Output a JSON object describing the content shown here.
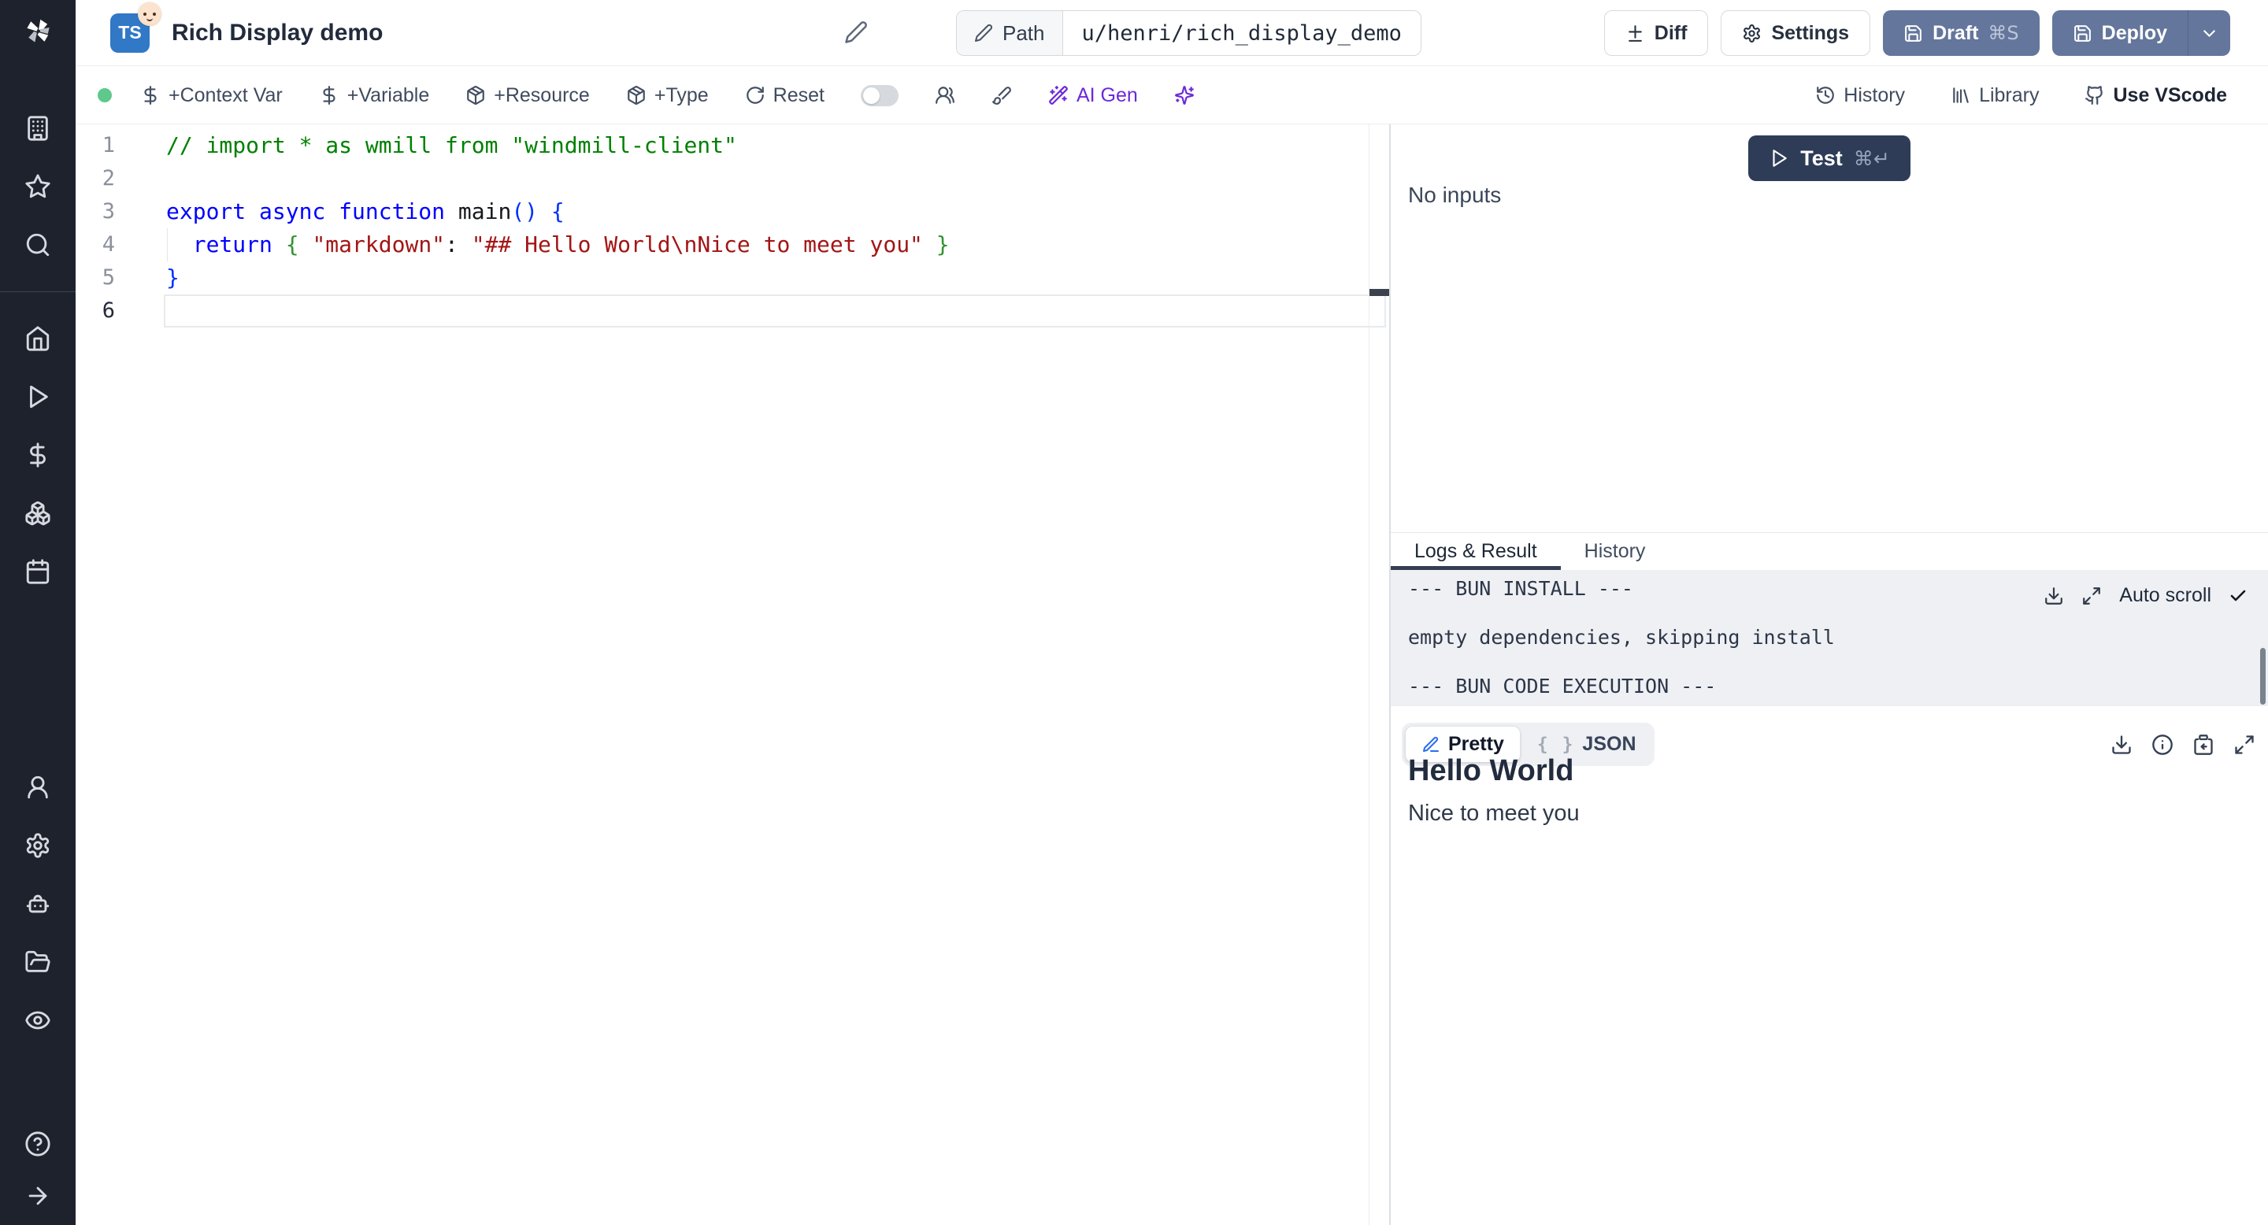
{
  "header": {
    "badge": "TS",
    "badge_emoji": "baby-face",
    "title": "Rich Display demo",
    "path_label": "Path",
    "path_value": "u/henri/rich_display_demo",
    "diff": "Diff",
    "settings": "Settings",
    "draft": "Draft",
    "draft_shortcut": "⌘S",
    "deploy": "Deploy"
  },
  "toolbar": {
    "context_var": "+Context Var",
    "variable": "+Variable",
    "resource": "+Resource",
    "type": "+Type",
    "reset": "Reset",
    "ai_gen": "AI Gen",
    "history": "History",
    "library": "Library",
    "vscode": "Use VScode"
  },
  "sidebar": {
    "icons": [
      "windmill-logo",
      "building",
      "star",
      "search",
      "home",
      "play",
      "dollar-sign",
      "boxes",
      "calendar",
      "user",
      "settings-gear",
      "robot",
      "folder-open",
      "eye",
      "help-circle",
      "arrow-right"
    ]
  },
  "editor": {
    "active_line": "6",
    "lines": [
      {
        "n": "1",
        "tokens": [
          [
            "c",
            "// import * as wmill from \"windmill-client\""
          ]
        ]
      },
      {
        "n": "2",
        "tokens": []
      },
      {
        "n": "3",
        "tokens": [
          [
            "k",
            "export async function "
          ],
          [
            "p",
            "main"
          ],
          [
            "b1",
            "()"
          ],
          [
            "p",
            " "
          ],
          [
            "b1",
            "{"
          ]
        ]
      },
      {
        "n": "4",
        "tokens": [
          [
            "p",
            "  "
          ],
          [
            "k",
            "return"
          ],
          [
            "p",
            " "
          ],
          [
            "b2",
            "{"
          ],
          [
            "p",
            " "
          ],
          [
            "s",
            "\"markdown\""
          ],
          [
            "p",
            ": "
          ],
          [
            "s",
            "\"## Hello World\\nNice to meet you\""
          ],
          [
            "p",
            " "
          ],
          [
            "b2",
            "}"
          ]
        ]
      },
      {
        "n": "5",
        "tokens": [
          [
            "b1",
            "}"
          ]
        ]
      },
      {
        "n": "6",
        "tokens": []
      }
    ]
  },
  "panel": {
    "test": "Test",
    "test_shortcut": "⌘↵",
    "no_inputs": "No inputs",
    "tab_logs": "Logs & Result",
    "tab_history": "History",
    "logs": [
      "--- BUN INSTALL ---",
      "",
      "empty dependencies, skipping install",
      "",
      "--- BUN CODE EXECUTION ---"
    ],
    "auto_scroll": "Auto scroll",
    "pretty": "Pretty",
    "braces": "{ }",
    "json": "JSON",
    "result_heading": "Hello World",
    "result_body": "Nice to meet you"
  },
  "colors": {
    "ts_badge": "#3178c6",
    "action_blue": "#64769b",
    "test_navy": "#2e3c57",
    "ai_purple": "#6d28d9",
    "status_green": "#5ec98b",
    "comment": "#008000",
    "keyword": "#0000ff",
    "string": "#a31515"
  }
}
